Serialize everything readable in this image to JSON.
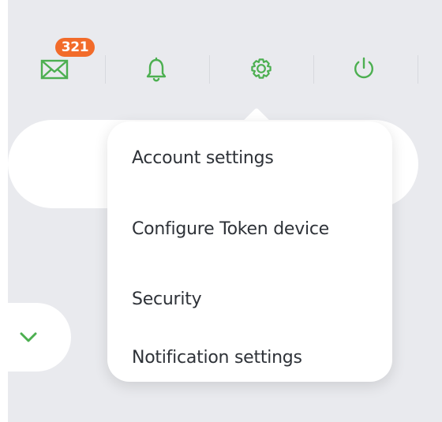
{
  "header": {
    "icons": [
      {
        "name": "mail-icon",
        "badge": "321"
      },
      {
        "name": "bell-icon"
      },
      {
        "name": "gear-icon"
      },
      {
        "name": "power-icon"
      }
    ],
    "accent_color": "#4caf50",
    "badge_color": "#f26b2a"
  },
  "dropdown": {
    "items": [
      {
        "label": "Account settings"
      },
      {
        "label": "Configure Token device"
      },
      {
        "label": "Security"
      },
      {
        "label": "Notification settings"
      }
    ]
  },
  "card": {
    "icon": "check-icon"
  }
}
